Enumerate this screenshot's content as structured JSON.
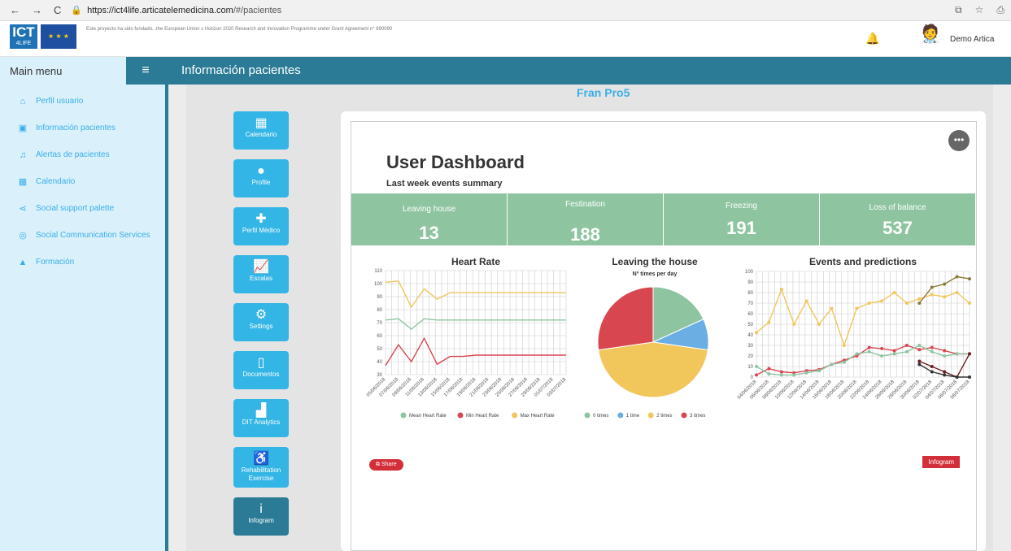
{
  "browser": {
    "url_host": "https://ict4life.articatelemedicina.com",
    "url_path": "/#/pacientes"
  },
  "topbar": {
    "logo_text": "ICT",
    "logo_sub": "4LIFE",
    "funding_text": "Este proyecto ha sido fundado...the European Union s Horizon 2020 Research and Innovation Programme under Grant Agreement n° 690090",
    "user_name": "Demo Artica"
  },
  "sidebar": {
    "title": "Main menu",
    "items": [
      {
        "label": "Perfil usuario",
        "icon": "home-icon"
      },
      {
        "label": "Información pacientes",
        "icon": "id-card-icon"
      },
      {
        "label": "Alertas de pacientes",
        "icon": "bell-icon"
      },
      {
        "label": "Calendario",
        "icon": "calendar-icon"
      },
      {
        "label": "Social support palette",
        "icon": "share-icon"
      },
      {
        "label": "Social Communication Services",
        "icon": "chat-icon"
      },
      {
        "label": "Formación",
        "icon": "graduation-icon"
      }
    ]
  },
  "main": {
    "title": "Información pacientes",
    "patient_name": "Fran Pro5"
  },
  "tiles": [
    {
      "label": "Calendario",
      "icon": "calendar-icon"
    },
    {
      "label": "Profile",
      "icon": "user-icon"
    },
    {
      "label": "Perfil Médico",
      "icon": "medical-icon"
    },
    {
      "label": "Escalas",
      "icon": "chart-line-icon"
    },
    {
      "label": "Settings",
      "icon": "gear-icon"
    },
    {
      "label": "Documentos",
      "icon": "document-icon"
    },
    {
      "label": "DIT Analytics",
      "icon": "area-chart-icon"
    },
    {
      "label": "Rehabilitation Exercise",
      "icon": "wheelchair-icon"
    },
    {
      "label": "Infogram",
      "icon": "info-icon"
    }
  ],
  "dashboard": {
    "title": "User Dashboard",
    "subtitle": "Last week events summary",
    "stats": [
      {
        "label": "Leaving house",
        "value": "13"
      },
      {
        "label": "Festination",
        "value": "188"
      },
      {
        "label": "Freezing",
        "value": "191"
      },
      {
        "label": "Loss of balance",
        "value": "537"
      }
    ],
    "share_label": "Share",
    "infogram_label": "Infogram"
  },
  "chart_data": [
    {
      "type": "line",
      "title": "Heart Rate",
      "ylim": [
        30,
        110
      ],
      "yticks": [
        30,
        40,
        50,
        60,
        70,
        80,
        90,
        100,
        110
      ],
      "categories": [
        "05/06/2018",
        "07/06/2018",
        "09/06/2018",
        "11/06/2018",
        "13/06/2018",
        "15/06/2018",
        "17/06/2018",
        "19/06/2018",
        "21/06/2018",
        "23/06/2018",
        "25/06/2018",
        "27/06/2018",
        "29/06/2018",
        "01/07/2018",
        "03/07/2018"
      ],
      "series": [
        {
          "name": "Mean Heart Rate",
          "color": "#8ec5a0",
          "values": [
            72,
            73,
            65,
            73,
            72,
            72,
            72,
            72,
            72,
            72,
            72,
            72,
            72,
            72,
            72
          ]
        },
        {
          "name": "Min Heart Rate",
          "color": "#d8474f",
          "values": [
            37,
            53,
            40,
            58,
            38,
            44,
            44,
            45,
            45,
            45,
            45,
            45,
            45,
            45,
            45
          ]
        },
        {
          "name": "Max Heart Rate",
          "color": "#f1c75b",
          "values": [
            101,
            102,
            82,
            96,
            88,
            93,
            93,
            93,
            93,
            93,
            93,
            93,
            93,
            93,
            93
          ]
        }
      ]
    },
    {
      "type": "pie",
      "title": "Leaving the house",
      "subtitle": "Nº times per day",
      "series": [
        {
          "name": "0 times",
          "color": "#8ec5a0",
          "value": 2
        },
        {
          "name": "1 time",
          "color": "#6aaee3",
          "value": 1
        },
        {
          "name": "2 times",
          "color": "#f1c75b",
          "value": 5
        },
        {
          "name": "3 times",
          "color": "#d8474f",
          "value": 3
        }
      ]
    },
    {
      "type": "line",
      "title": "Events and predictions",
      "ylim": [
        0,
        100
      ],
      "yticks": [
        0,
        10,
        20,
        30,
        40,
        50,
        60,
        70,
        80,
        90,
        100
      ],
      "categories": [
        "04/06/2018",
        "06/06/2018",
        "08/06/2018",
        "10/06/2018",
        "12/06/2018",
        "14/06/2018",
        "16/06/2018",
        "18/06/2018",
        "20/06/2018",
        "22/06/2018",
        "24/06/2018",
        "26/06/2018",
        "28/06/2018",
        "30/06/2018",
        "02/07/2018",
        "04/07/2018",
        "06/07/2018",
        "08/07/2018"
      ],
      "series": [
        {
          "color": "#f1c75b",
          "values": [
            42,
            52,
            83,
            50,
            72,
            50,
            65,
            30,
            65,
            70,
            72,
            80,
            70,
            74,
            78,
            76,
            80,
            70
          ]
        },
        {
          "color": "#d8474f",
          "values": [
            2,
            8,
            5,
            4,
            6,
            7,
            12,
            16,
            20,
            28,
            27,
            25,
            30,
            26,
            28,
            25,
            22,
            22
          ]
        },
        {
          "color": "#8ec5a0",
          "values": [
            10,
            3,
            2,
            2,
            4,
            6,
            12,
            14,
            22,
            24,
            20,
            22,
            24,
            30,
            24,
            20,
            22,
            22
          ]
        }
      ],
      "predictions": [
        {
          "color": "#8b7b3a",
          "values": [
            70,
            85,
            88,
            95,
            93
          ]
        },
        {
          "color": "#6b1f22",
          "values": [
            15,
            10,
            5,
            0,
            22
          ]
        },
        {
          "color": "#333333",
          "values": [
            12,
            5,
            2,
            0,
            0
          ]
        }
      ]
    }
  ]
}
